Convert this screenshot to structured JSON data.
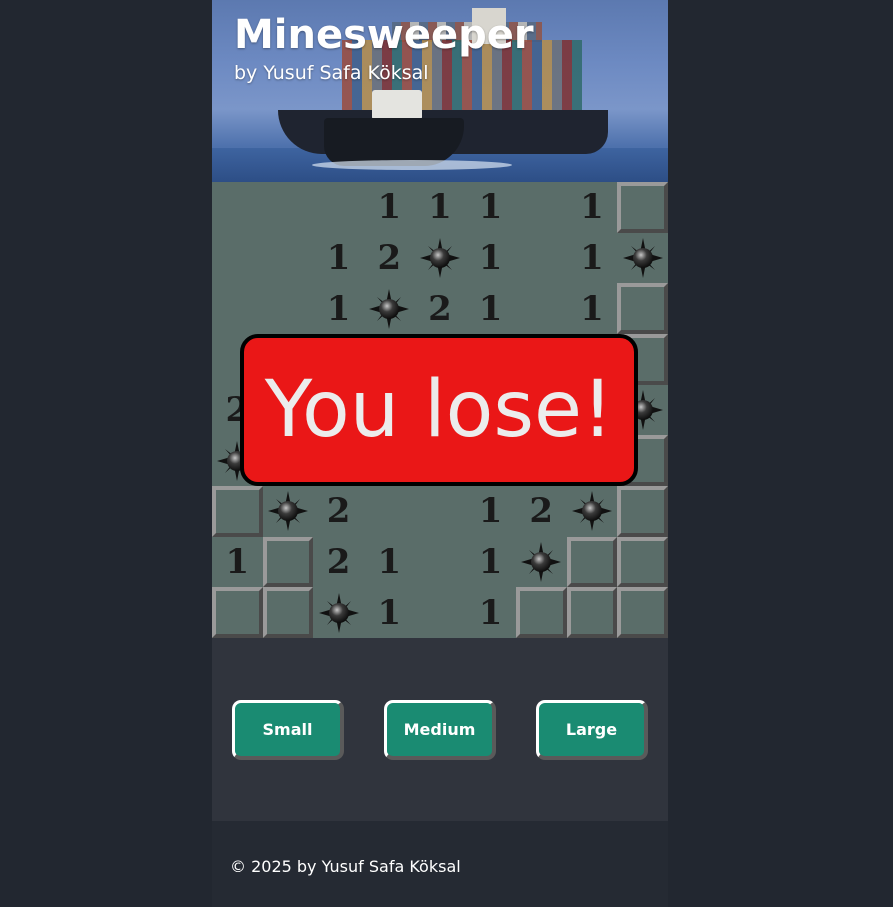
{
  "header": {
    "title": "Minesweeper",
    "subtitle": "by Yusuf Safa Köksal"
  },
  "board": {
    "rows": 9,
    "cols": 9,
    "cells": [
      [
        "",
        "",
        "",
        "1",
        "1",
        "1",
        "",
        "1",
        "H"
      ],
      [
        "",
        "",
        "1",
        "2",
        "M",
        "1",
        "",
        "1",
        "M"
      ],
      [
        "",
        "",
        "1",
        "M",
        "2",
        "1",
        "",
        "1",
        "H"
      ],
      [
        "",
        "",
        "",
        "",
        "",
        "",
        "",
        "",
        "H"
      ],
      [
        "2",
        "",
        "",
        "",
        "",
        "",
        "",
        "",
        "M"
      ],
      [
        "M",
        "",
        "",
        "",
        "",
        "",
        "",
        "",
        "H"
      ],
      [
        "H",
        "M",
        "2",
        "",
        "",
        "1",
        "2",
        "M",
        "H"
      ],
      [
        "1",
        "H",
        "2",
        "1",
        "",
        "1",
        "M",
        "H",
        "H"
      ],
      [
        "H",
        "H",
        "M",
        "1",
        "",
        "1",
        "H",
        "H",
        "H"
      ]
    ]
  },
  "status": {
    "message": "You lose!"
  },
  "size_buttons": {
    "small": "Small",
    "medium": "Medium",
    "large": "Large"
  },
  "footer": {
    "text": "© 2025 by Yusuf Safa Köksal"
  },
  "colors": {
    "board": "#5a6d69",
    "lose_banner": "#ea1717",
    "button": "#1a8b72",
    "page_bg": "#222730"
  }
}
